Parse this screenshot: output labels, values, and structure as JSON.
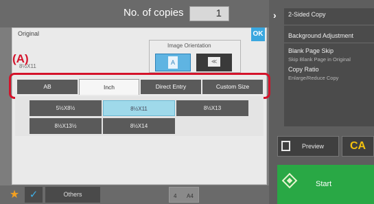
{
  "header": {
    "copies_label": "No. of copies",
    "copies_value": "1"
  },
  "right_panel": {
    "items": [
      {
        "label": "2-Sided Copy",
        "sub": ""
      },
      {
        "label": "Background Adjustment",
        "sub": ""
      },
      {
        "label": "Blank Page Skip",
        "sub": "Skip Blank Page in Original"
      },
      {
        "label": "Copy Ratio",
        "sub": "Enlarge/Reduce Copy"
      }
    ],
    "preview_label": "Preview",
    "ca_label": "CA",
    "start_label": "Start"
  },
  "bottom_bar": {
    "others_label": "Others",
    "tray_labels": [
      "4",
      "A4"
    ]
  },
  "dialog": {
    "title": "Original",
    "ok_label": "OK",
    "size_text": "8½X11",
    "orientation": {
      "title": "Image Orientation",
      "portrait_glyph": "A",
      "landscape_glyph": "≪"
    },
    "callout_label": "(A)",
    "tabs": [
      {
        "label": "AB",
        "selected": false
      },
      {
        "label": "Inch",
        "selected": true
      },
      {
        "label": "Direct Entry",
        "selected": false
      },
      {
        "label": "Custom Size",
        "selected": false
      }
    ],
    "sizes": [
      {
        "label": "5½X8½",
        "selected": false
      },
      {
        "label": "8½X11",
        "selected": true
      },
      {
        "label": "8½X13",
        "selected": false
      },
      {
        "label": "8½X13½",
        "selected": false
      },
      {
        "label": "8½X14",
        "selected": false
      }
    ]
  },
  "colors": {
    "accent_blue": "#3aa7df",
    "start_green": "#29a845",
    "callout_red": "#d4122a",
    "ca_yellow": "#f4c20d",
    "selected_size": "#9fd9ea"
  },
  "icons": [
    "chevron-right-icon",
    "preview-icon",
    "start-diamond-icon",
    "star-icon",
    "checkmark-icon"
  ]
}
